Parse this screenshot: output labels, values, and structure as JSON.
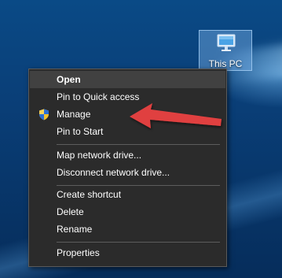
{
  "desktop": {
    "icon_label": "This PC",
    "icon_name": "monitor-icon"
  },
  "context_menu": {
    "items": [
      {
        "label": "Open",
        "bold": true,
        "highlighted": true
      },
      {
        "label": "Pin to Quick access"
      },
      {
        "label": "Manage",
        "icon": "uac-shield-icon"
      },
      {
        "label": "Pin to Start"
      },
      {
        "label": "Map network drive..."
      },
      {
        "label": "Disconnect network drive..."
      },
      {
        "label": "Create shortcut"
      },
      {
        "label": "Delete"
      },
      {
        "label": "Rename"
      },
      {
        "label": "Properties"
      }
    ]
  },
  "annotation": {
    "arrow_color": "#e04040"
  },
  "colors": {
    "menu_background": "#2b2b2b",
    "menu_highlight": "#414141",
    "desktop_background": "#0a4a86"
  }
}
